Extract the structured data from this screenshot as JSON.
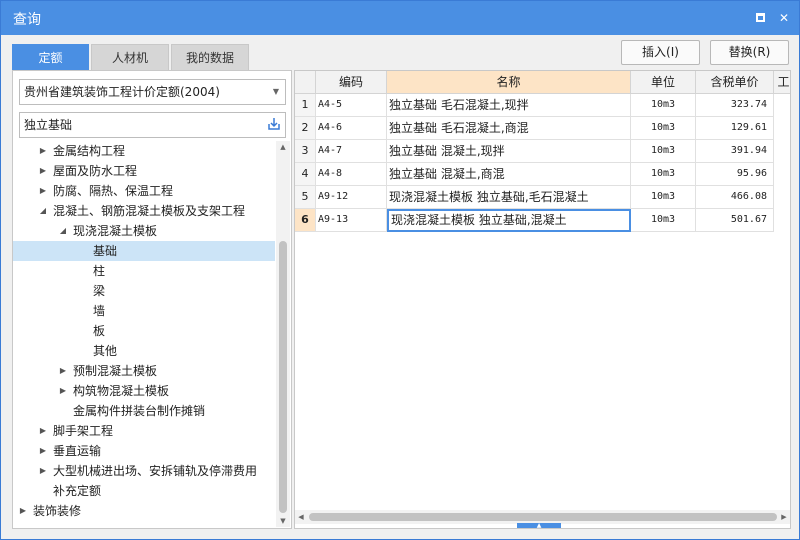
{
  "window": {
    "title": "查询",
    "maximize_glyph": "",
    "close_glyph": "✕"
  },
  "tabs": [
    {
      "label": "定额",
      "active": true
    },
    {
      "label": "人材机",
      "active": false
    },
    {
      "label": "我的数据",
      "active": false
    }
  ],
  "toolbar": {
    "insert_label": "插入(I)",
    "replace_label": "替换(R)"
  },
  "left": {
    "quota_select": "贵州省建筑装饰工程计价定额(2004)",
    "search_value": "独立基础",
    "tree": [
      {
        "label": "金属结构工程",
        "arrow": "▶"
      },
      {
        "label": "屋面及防水工程",
        "arrow": "▶"
      },
      {
        "label": "防腐、隔热、保温工程",
        "arrow": "▶"
      },
      {
        "label": "混凝土、钢筋混凝土模板及支架工程",
        "arrow": "◢"
      },
      {
        "label": "现浇混凝土模板",
        "arrow": "◢"
      },
      {
        "label": "基础",
        "arrow": ""
      },
      {
        "label": "柱",
        "arrow": ""
      },
      {
        "label": "梁",
        "arrow": ""
      },
      {
        "label": "墙",
        "arrow": ""
      },
      {
        "label": "板",
        "arrow": ""
      },
      {
        "label": "其他",
        "arrow": ""
      },
      {
        "label": "预制混凝土模板",
        "arrow": "▶"
      },
      {
        "label": "构筑物混凝土模板",
        "arrow": "▶"
      },
      {
        "label": "金属构件拼装台制作摊销",
        "arrow": ""
      },
      {
        "label": "脚手架工程",
        "arrow": "▶"
      },
      {
        "label": "垂直运输",
        "arrow": "▶"
      },
      {
        "label": "大型机械进出场、安拆铺轨及停滞费用",
        "arrow": "▶"
      },
      {
        "label": "补充定额",
        "arrow": ""
      },
      {
        "label": "装饰装修",
        "arrow": "▶"
      }
    ]
  },
  "grid": {
    "headers": {
      "code": "编码",
      "name": "名称",
      "unit": "单位",
      "price": "含税单价",
      "extra": "工"
    },
    "rows": [
      {
        "no": "1",
        "code": "A4-5",
        "name": "独立基础 毛石混凝土,现拌",
        "unit": "10m3",
        "price": "323.74"
      },
      {
        "no": "2",
        "code": "A4-6",
        "name": "独立基础 毛石混凝土,商混",
        "unit": "10m3",
        "price": "129.61"
      },
      {
        "no": "3",
        "code": "A4-7",
        "name": "独立基础 混凝土,现拌",
        "unit": "10m3",
        "price": "391.94"
      },
      {
        "no": "4",
        "code": "A4-8",
        "name": "独立基础 混凝土,商混",
        "unit": "10m3",
        "price": "95.96"
      },
      {
        "no": "5",
        "code": "A9-12",
        "name": "现浇混凝土模板 独立基础,毛石混凝土",
        "unit": "10m3",
        "price": "466.08"
      },
      {
        "no": "6",
        "code": "A9-13",
        "name": "现浇混凝土模板 独立基础,混凝土",
        "unit": "10m3",
        "price": "501.67"
      }
    ]
  }
}
